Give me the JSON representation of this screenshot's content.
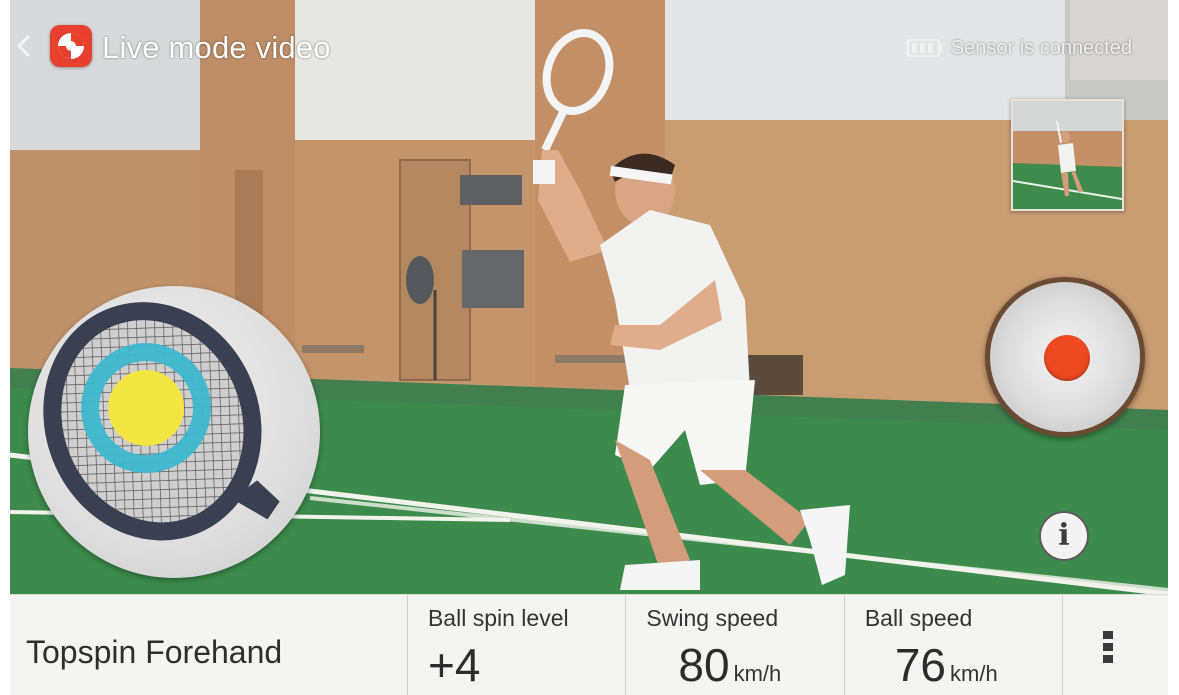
{
  "header": {
    "title": "Live mode video",
    "sensor_status": "Sensor is connected"
  },
  "icons": {
    "back": "chevron-left-icon",
    "app": "app-logo-icon",
    "sensor": "battery-icon",
    "record": "record-icon",
    "info": "info-icon",
    "menu": "overflow-menu-icon"
  },
  "stats": {
    "stroke_type": "Topspin Forehand",
    "ball_spin": {
      "label": "Ball spin level",
      "value": "+4"
    },
    "swing_speed": {
      "label": "Swing speed",
      "value": "80",
      "unit": "km/h"
    },
    "ball_speed": {
      "label": "Ball speed",
      "value": "76",
      "unit": "km/h"
    }
  },
  "colors": {
    "record": "#ee4a22",
    "impact_center": "#f3e542",
    "impact_ring": "#3db8cf",
    "racket_frame": "#3a3f52",
    "court": "#3c8a4c",
    "wall": "#c08e66"
  }
}
